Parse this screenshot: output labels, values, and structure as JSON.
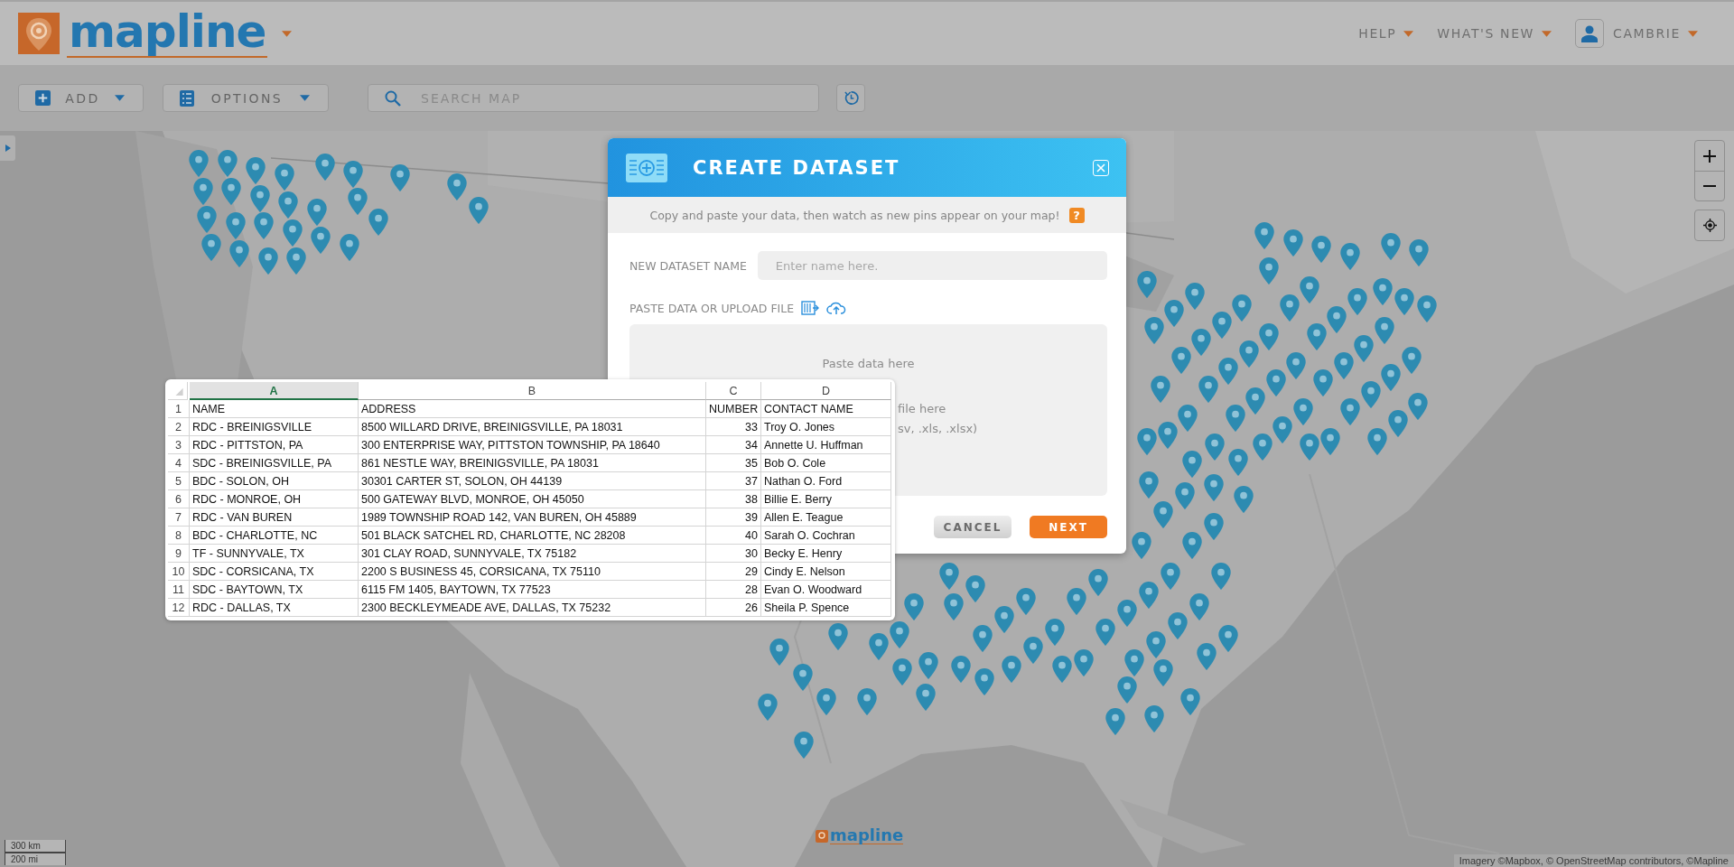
{
  "header": {
    "logo_text": "mapline",
    "nav": [
      {
        "label": "HELP"
      },
      {
        "label": "WHAT'S NEW"
      }
    ],
    "user": {
      "name": "CAMBRIE"
    }
  },
  "toolbar": {
    "buttons": [
      {
        "label": "ADD",
        "kind": "add"
      },
      {
        "label": "OPTIONS",
        "kind": "options"
      }
    ],
    "search": {
      "placeholder": "SEARCH MAP"
    }
  },
  "map": {
    "scale": [
      "300 km",
      "200 mi"
    ],
    "attribution": "Imagery ©Mapbox, © OpenStreetMap contributors, ©Mapline",
    "watermark": "mapline"
  },
  "dialog": {
    "title": "CREATE DATASET",
    "subtitle": "Copy and paste your data, then watch as new pins appear on your map!",
    "help": "?",
    "name_label": "NEW DATASET NAME",
    "name_placeholder": "Enter name here.",
    "paste_label": "PASTE DATA OR UPLOAD FILE",
    "dropzone": [
      "Paste data here",
      "file here",
      "sv, .xls, .xlsx)"
    ],
    "buttons": [
      {
        "label": "CANCEL",
        "kind": "secondary"
      },
      {
        "label": "NEXT",
        "kind": "primary"
      }
    ]
  },
  "sheet": {
    "columns": [
      {
        "letter": "A",
        "selected": true
      },
      {
        "letter": "B",
        "selected": false
      },
      {
        "letter": "C",
        "selected": false
      },
      {
        "letter": "D",
        "selected": false
      }
    ],
    "rows": [
      {
        "number": "1",
        "cells": [
          "NAME",
          "ADDRESS",
          "NUMBER",
          "CONTACT NAME"
        ]
      },
      {
        "number": "2",
        "cells": [
          "RDC - BREINIGSVILLE",
          "8500 WILLARD DRIVE, BREINIGSVILLE, PA 18031",
          "33",
          "Troy O. Jones"
        ]
      },
      {
        "number": "3",
        "cells": [
          "RDC - PITTSTON, PA",
          "300 ENTERPRISE WAY, PITTSTON TOWNSHIP, PA 18640",
          "34",
          "Annette U. Huffman"
        ]
      },
      {
        "number": "4",
        "cells": [
          "SDC - BREINIGSVILLE, PA",
          "861 NESTLE WAY, BREINIGSVILLE, PA 18031",
          "35",
          "Bob O. Cole"
        ]
      },
      {
        "number": "5",
        "cells": [
          "BDC - SOLON, OH",
          "30301 CARTER ST, SOLON, OH 44139",
          "37",
          "Nathan O. Ford"
        ]
      },
      {
        "number": "6",
        "cells": [
          "RDC - MONROE, OH",
          "500 GATEWAY BLVD, MONROE, OH 45050",
          "38",
          "Billie E. Berry"
        ]
      },
      {
        "number": "7",
        "cells": [
          "RDC - VAN BUREN",
          "1989 TOWNSHIP ROAD 142, VAN BUREN, OH 45889",
          "39",
          "Allen E. Teague"
        ]
      },
      {
        "number": "8",
        "cells": [
          "BDC - CHARLOTTE, NC",
          "501 BLACK SATCHEL RD, CHARLOTTE, NC 28208",
          "40",
          "Sarah O. Cochran"
        ]
      },
      {
        "number": "9",
        "cells": [
          "TF - SUNNYVALE, TX",
          "301 CLAY ROAD, SUNNYVALE, TX 75182",
          "30",
          "Becky E. Henry"
        ]
      },
      {
        "number": "10",
        "cells": [
          "SDC - CORSICANA, TX",
          "2200 S BUSINESS 45, CORSICANA, TX 75110",
          "29",
          "Cindy E. Nelson"
        ]
      },
      {
        "number": "11",
        "cells": [
          "SDC - BAYTOWN, TX",
          "6115 FM 1405, BAYTOWN, TX 77523",
          "28",
          "Evan O. Woodward"
        ]
      },
      {
        "number": "12",
        "cells": [
          "RDC - DALLAS, TX",
          "2300 BECKLEYMEADE AVE, DALLAS, TX 75232",
          "26",
          "Sheila P. Spence"
        ]
      }
    ]
  }
}
